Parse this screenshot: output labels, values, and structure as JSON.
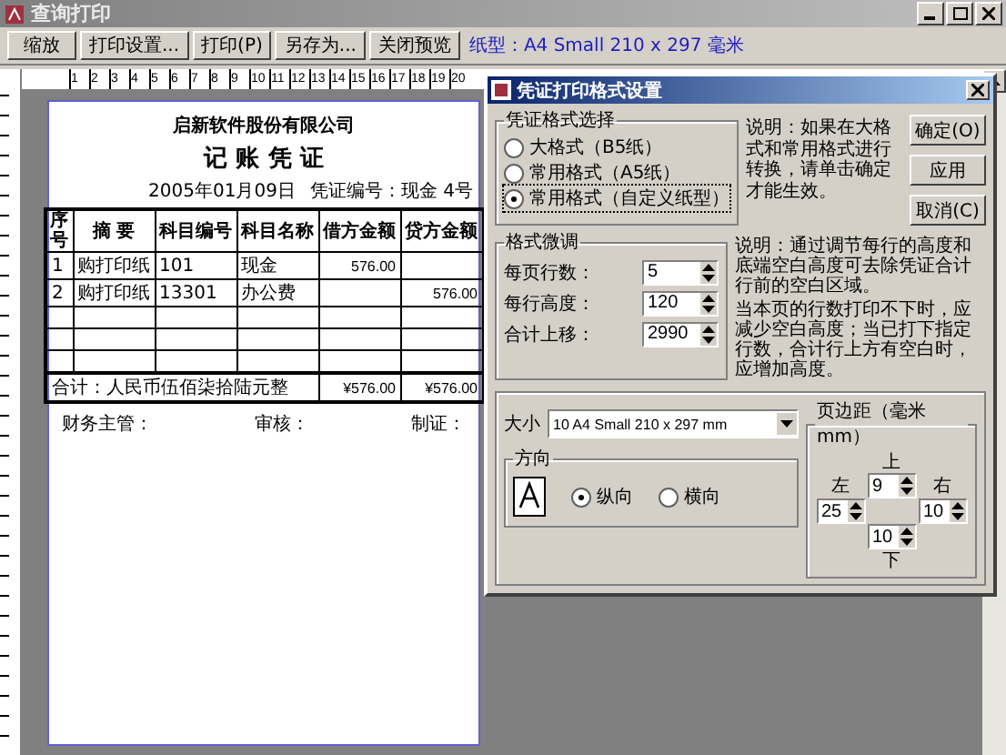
{
  "window": {
    "title": "查询打印"
  },
  "toolbar": {
    "buttons": [
      "缩放",
      "打印设置...",
      "打印(P)",
      "另存为...",
      "关闭预览"
    ],
    "paper_info": "纸型：A4 Small 210 x 297 毫米"
  },
  "ruler": {
    "marks": [
      "1",
      "2",
      "3",
      "4",
      "5",
      "6",
      "7",
      "8",
      "9",
      "10",
      "11",
      "12",
      "13",
      "14",
      "15",
      "16",
      "17",
      "18",
      "19",
      "20"
    ]
  },
  "voucher": {
    "company": "启新软件股份有限公司",
    "title": "记 账 凭 证",
    "date": "2005年01月09日",
    "number": "凭证编号：现金 4号",
    "columns": [
      "序号",
      "摘 要",
      "科目编号",
      "科目名称",
      "借方金额",
      "贷方金额"
    ],
    "rows": [
      {
        "cells": [
          "1",
          "购打印纸",
          "101",
          "现金",
          "576.00",
          null
        ]
      },
      {
        "cells": [
          "2",
          "购打印纸",
          "13301",
          "办公费",
          null,
          "576.00"
        ]
      }
    ],
    "total": {
      "label": "合计：人民币伍佰柒拾陆元整",
      "debit": "¥576.00",
      "credit": "¥576.00"
    },
    "signatures": [
      "财务主管：",
      "审核：",
      "制证："
    ]
  },
  "dialog": {
    "title": "凭证打印格式设置",
    "format_group": {
      "title": "凭证格式选择",
      "options": [
        {
          "label": "大格式（B5纸）",
          "selected": false
        },
        {
          "label": "常用格式（A5纸）",
          "selected": false
        },
        {
          "label": "常用格式（自定义纸型）",
          "selected": true
        }
      ]
    },
    "note_1": "说明：如果在大格式和常用格式进行转换，请单击确定才能生效。",
    "buttons": [
      "确定(O)",
      "应用",
      "取消(C)"
    ],
    "tuning_group": {
      "title": "格式微调",
      "fields": [
        {
          "label": "每页行数：",
          "value": "5"
        },
        {
          "label": "每行高度：",
          "value": "120"
        },
        {
          "label": "合计上移：",
          "value": "2990"
        }
      ]
    },
    "note_2": "说明：通过调节每行的高度和底端空白高度可去除凭证合计行前的空白区域。",
    "note_3": "当本页的行数打印不下时，应减少空白高度；当已打下指定行数，合计行上方有空白时，应增加高度。",
    "size": {
      "label": "大小",
      "value": "10 A4 Small 210 x 297 mm"
    },
    "orientation": {
      "title": "方向",
      "options": [
        {
          "label": "纵向",
          "selected": true
        },
        {
          "label": "横向",
          "selected": false
        }
      ]
    },
    "margins": {
      "title": "页边距（毫米 mm）",
      "top": {
        "label": "上",
        "value": "9"
      },
      "left": {
        "label": "左",
        "value": "25"
      },
      "right": {
        "label": "右",
        "value": "10"
      },
      "bottom": {
        "label": "下",
        "value": "10"
      }
    }
  }
}
